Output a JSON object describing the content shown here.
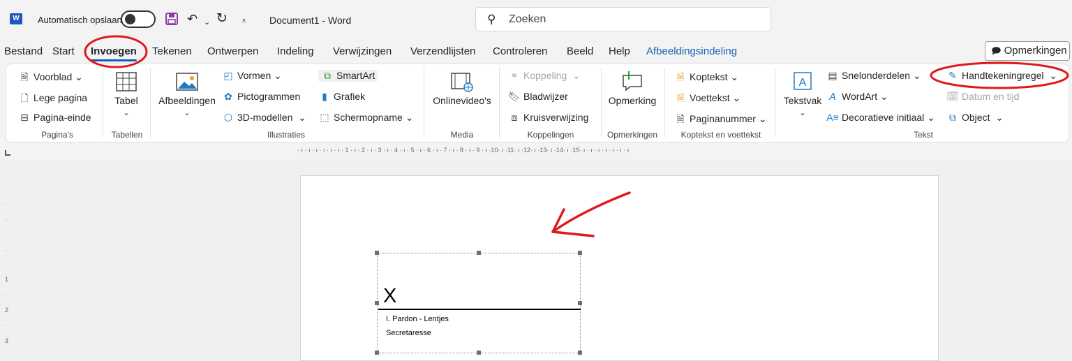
{
  "titlebar": {
    "app_logo": "W",
    "autosave_label": "Automatisch opslaan",
    "doc_title": "Document1  -  Word",
    "search_placeholder": "Zoeken"
  },
  "menu": {
    "tabs": [
      "Bestand",
      "Start",
      "Invoegen",
      "Tekenen",
      "Ontwerpen",
      "Indeling",
      "Verwijzingen",
      "Verzendlijsten",
      "Controleren",
      "Beeld",
      "Help",
      "Afbeeldingsindeling"
    ],
    "active_tab": "Invoegen",
    "comments_label": "Opmerkingen"
  },
  "ribbon": {
    "pages": {
      "voorblad": "Voorblad",
      "lege_pagina": "Lege pagina",
      "pagina_einde": "Pagina-einde",
      "group": "Pagina's"
    },
    "tables": {
      "tabel": "Tabel",
      "group": "Tabellen"
    },
    "illustrations": {
      "afbeeldingen": "Afbeeldingen",
      "vormen": "Vormen",
      "pictogrammen": "Pictogrammen",
      "modellen": "3D-modellen",
      "smartart": "SmartArt",
      "grafiek": "Grafiek",
      "schermopname": "Schermopname",
      "group": "Illustraties"
    },
    "media": {
      "onlinevideo": "Onlinevideo's",
      "group": "Media"
    },
    "links": {
      "koppeling": "Koppeling",
      "bladwijzer": "Bladwijzer",
      "kruisverwijzing": "Kruisverwijzing",
      "group": "Koppelingen"
    },
    "comments": {
      "opmerking": "Opmerking",
      "group": "Opmerkingen"
    },
    "header_footer": {
      "koptekst": "Koptekst",
      "voettekst": "Voettekst",
      "paginanummer": "Paginanummer",
      "group": "Koptekst en voettekst"
    },
    "text": {
      "tekstvak": "Tekstvak",
      "snelonderdelen": "Snelonderdelen",
      "wordart": "WordArt",
      "decoratieve": "Decoratieve initiaal",
      "handtekeningregel": "Handtekeningregel",
      "datum": "Datum en tijd",
      "object": "Object",
      "group": "Tekst"
    }
  },
  "ruler": {
    "ticks": "· ı · ı · ı · ı · ı · ı · 1 · ı · 2 · ı · 3 · ı · 4 · ı · 5 · ı · 6 · ı · 7 · ı · 8 · ı · 9 · ı ·10· ı ·11· ı ·12· ı ·13· ı ·14· ı ·15· ı · ı · ı · ı · ı · ı · ı",
    "vertical": [
      "·",
      "·",
      "·",
      "·",
      "1",
      "·",
      "2",
      "·",
      "3"
    ]
  },
  "signature": {
    "x_mark": "X",
    "name": "I. Pardon - Lentjes",
    "title": "Secretaresse"
  },
  "colors": {
    "accent": "#185abd",
    "annotation": "#e0191b",
    "context_tab": "#1b5fb5"
  }
}
